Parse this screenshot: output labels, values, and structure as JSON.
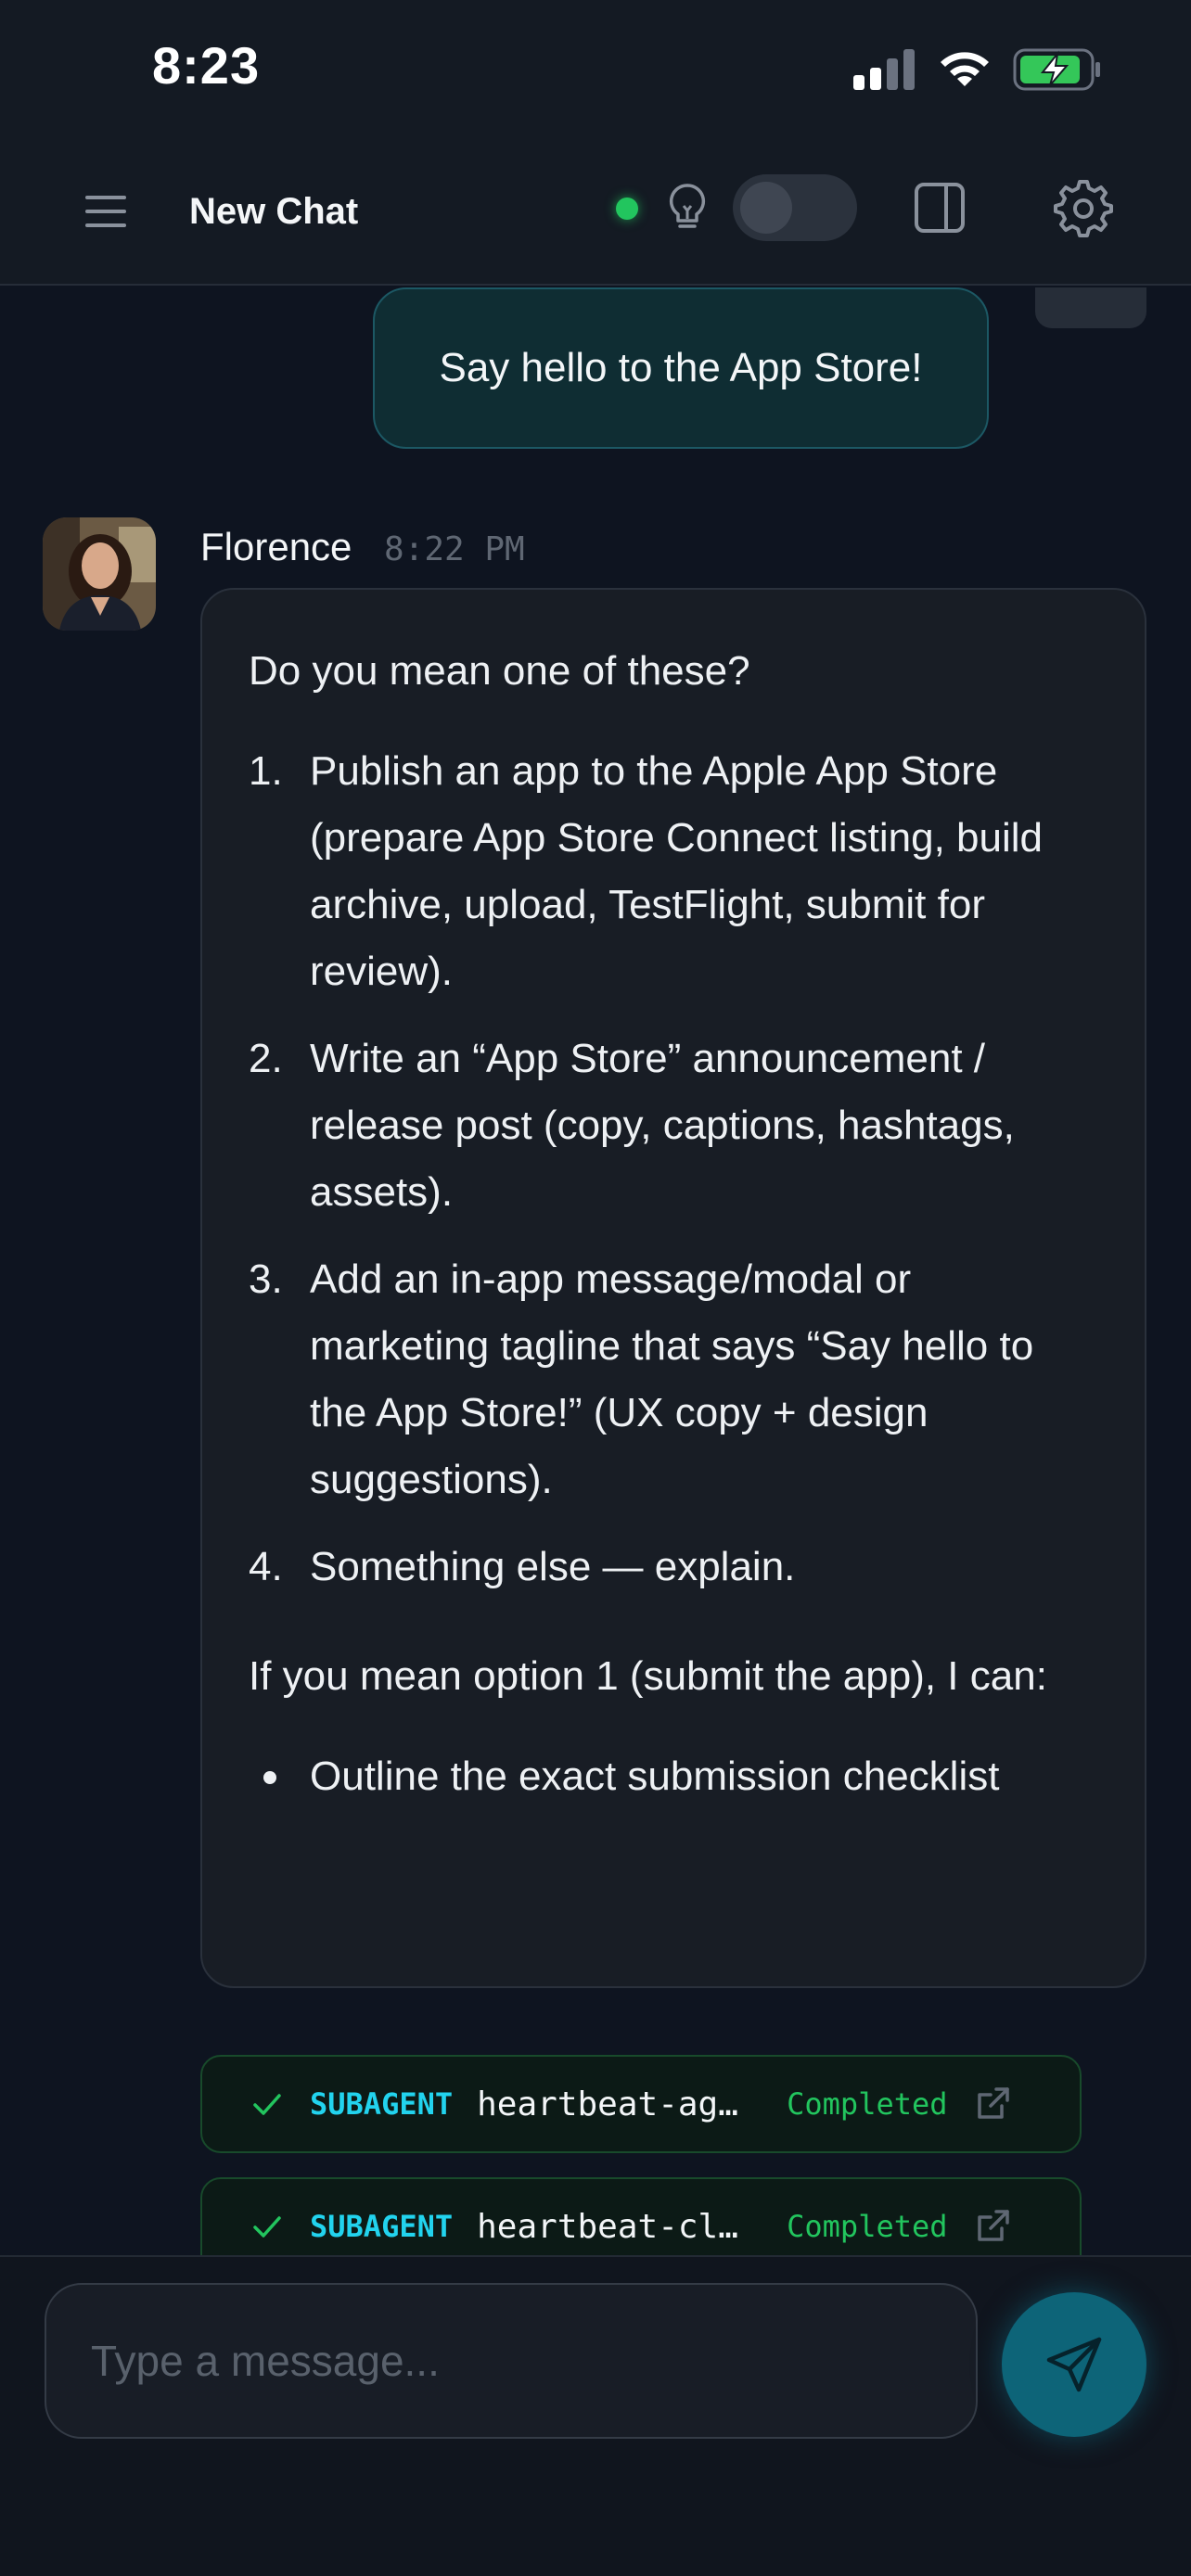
{
  "status_bar": {
    "time": "8:23",
    "icons": [
      "cellular-signal-icon",
      "wifi-icon",
      "battery-charging-icon"
    ]
  },
  "header": {
    "title": "New Chat",
    "icons": [
      "menu-icon",
      "lightbulb-icon",
      "sidebar-panel-icon",
      "gear-icon"
    ],
    "online_color": "#22c55e"
  },
  "messages": {
    "user_message": "Say hello to the App Store!",
    "assistant": {
      "name": "Florence",
      "time": "8:22 PM",
      "intro": "Do you mean one of these?",
      "options": [
        {
          "num": "1.",
          "text": "Publish an app to the Apple App Store (prepare App Store Connect listing, build archive, upload, TestFlight, submit for review)."
        },
        {
          "num": "2.",
          "text": "Write an “App Store” announcement / release post (copy, captions, hashtags, assets)."
        },
        {
          "num": "3.",
          "text": "Add an in-app message/modal or marketing tagline that says “Say hello to the App Store!” (UX copy + design suggestions)."
        },
        {
          "num": "4.",
          "text": "Something else — explain."
        }
      ],
      "outro": "If you mean option 1 (submit the app), I can:",
      "bullets": [
        "Outline the exact submission checklist"
      ]
    },
    "subagents": [
      {
        "tag": "SUBAGENT",
        "name": "heartbeat-ag…",
        "status": "Completed"
      },
      {
        "tag": "SUBAGENT",
        "name": "heartbeat-cl…",
        "status": "Completed"
      }
    ]
  },
  "composer": {
    "placeholder": "Type a message...",
    "send_icon": "send-icon",
    "accent": "#0d6478"
  }
}
